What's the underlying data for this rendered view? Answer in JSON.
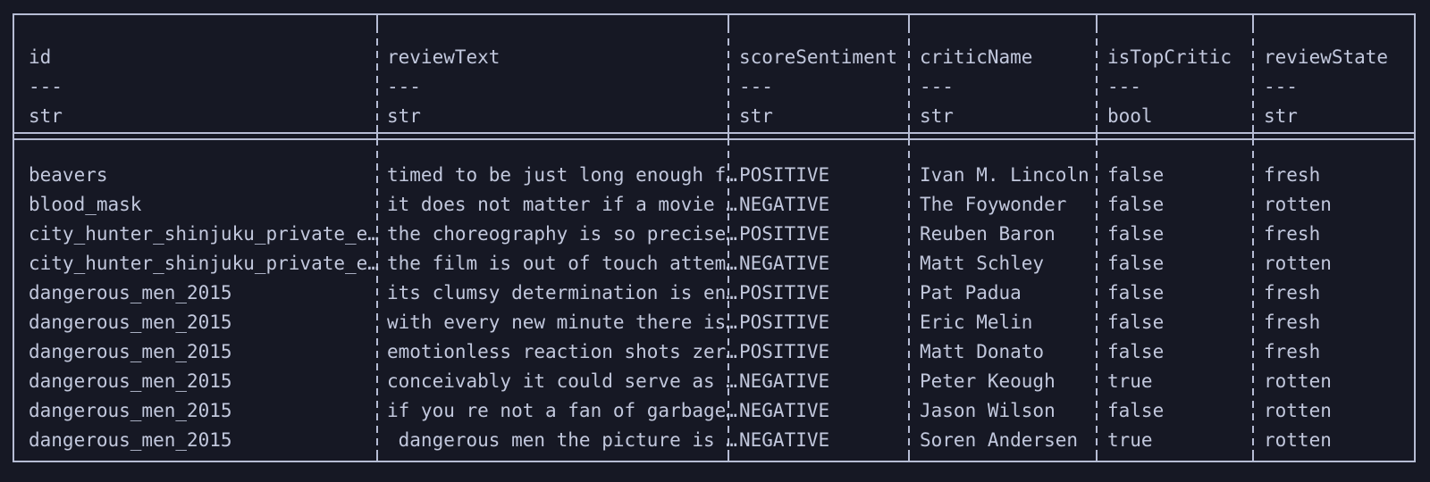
{
  "table": {
    "type": "dataframe-preview",
    "columns": [
      {
        "name": "id",
        "dtype": "str",
        "dash": "---"
      },
      {
        "name": "reviewText",
        "dtype": "str",
        "dash": "---"
      },
      {
        "name": "scoreSentiment",
        "dtype": "str",
        "dash": "---"
      },
      {
        "name": "criticName",
        "dtype": "str",
        "dash": "---"
      },
      {
        "name": "isTopCritic",
        "dtype": "bool",
        "dash": "---"
      },
      {
        "name": "reviewState",
        "dtype": "str",
        "dash": "---"
      }
    ],
    "rows": [
      {
        "id": "beavers",
        "reviewText": "timed to be just long enough f…",
        "scoreSentiment": "POSITIVE",
        "criticName": "Ivan M. Lincoln",
        "isTopCritic": "false",
        "reviewState": "fresh"
      },
      {
        "id": "blood_mask",
        "reviewText": "it does not matter if a movie …",
        "scoreSentiment": "NEGATIVE",
        "criticName": "The Foywonder",
        "isTopCritic": "false",
        "reviewState": "rotten"
      },
      {
        "id": "city_hunter_shinjuku_private_e…",
        "reviewText": "the choreography is so precise…",
        "scoreSentiment": "POSITIVE",
        "criticName": "Reuben Baron",
        "isTopCritic": "false",
        "reviewState": "fresh"
      },
      {
        "id": "city_hunter_shinjuku_private_e…",
        "reviewText": "the film is out of touch attem…",
        "scoreSentiment": "NEGATIVE",
        "criticName": "Matt Schley",
        "isTopCritic": "false",
        "reviewState": "rotten"
      },
      {
        "id": "dangerous_men_2015",
        "reviewText": "its clumsy determination is en…",
        "scoreSentiment": "POSITIVE",
        "criticName": "Pat Padua",
        "isTopCritic": "false",
        "reviewState": "fresh"
      },
      {
        "id": "dangerous_men_2015",
        "reviewText": "with every new minute there is…",
        "scoreSentiment": "POSITIVE",
        "criticName": "Eric Melin",
        "isTopCritic": "false",
        "reviewState": "fresh"
      },
      {
        "id": "dangerous_men_2015",
        "reviewText": "emotionless reaction shots zer…",
        "scoreSentiment": "POSITIVE",
        "criticName": "Matt Donato",
        "isTopCritic": "false",
        "reviewState": "fresh"
      },
      {
        "id": "dangerous_men_2015",
        "reviewText": "conceivably it could serve as …",
        "scoreSentiment": "NEGATIVE",
        "criticName": "Peter Keough",
        "isTopCritic": "true",
        "reviewState": "rotten"
      },
      {
        "id": "dangerous_men_2015",
        "reviewText": "if you re not a fan of garbage…",
        "scoreSentiment": "NEGATIVE",
        "criticName": "Jason Wilson",
        "isTopCritic": "false",
        "reviewState": "rotten"
      },
      {
        "id": "dangerous_men_2015",
        "reviewText": " dangerous men the picture is …",
        "scoreSentiment": "NEGATIVE",
        "criticName": "Soren Andersen",
        "isTopCritic": "true",
        "reviewState": "rotten"
      }
    ]
  },
  "colors": {
    "background": "#161824",
    "text": "#c2c8dd",
    "rule": "#b6bcd4"
  }
}
